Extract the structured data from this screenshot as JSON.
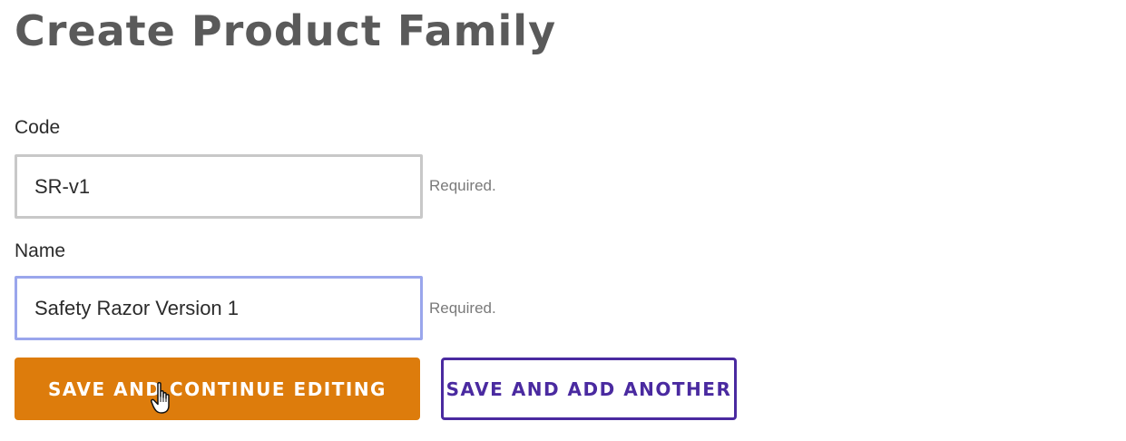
{
  "page": {
    "title": "Create Product Family"
  },
  "form": {
    "code": {
      "label": "Code",
      "value": "SR-v1",
      "help": "Required."
    },
    "name": {
      "label": "Name",
      "value": "Safety Razor Version 1",
      "help": "Required."
    }
  },
  "actions": {
    "save_continue_label": "SAVE AND CONTINUE EDITING",
    "save_add_label": "SAVE AND ADD ANOTHER"
  },
  "colors": {
    "title": "#5a5a5a",
    "primary_button": "#dd7c0c",
    "secondary_button": "#4a2aa0",
    "focused_border": "#9aa6ec"
  },
  "icons": {
    "cursor": "hand-pointer-icon"
  }
}
